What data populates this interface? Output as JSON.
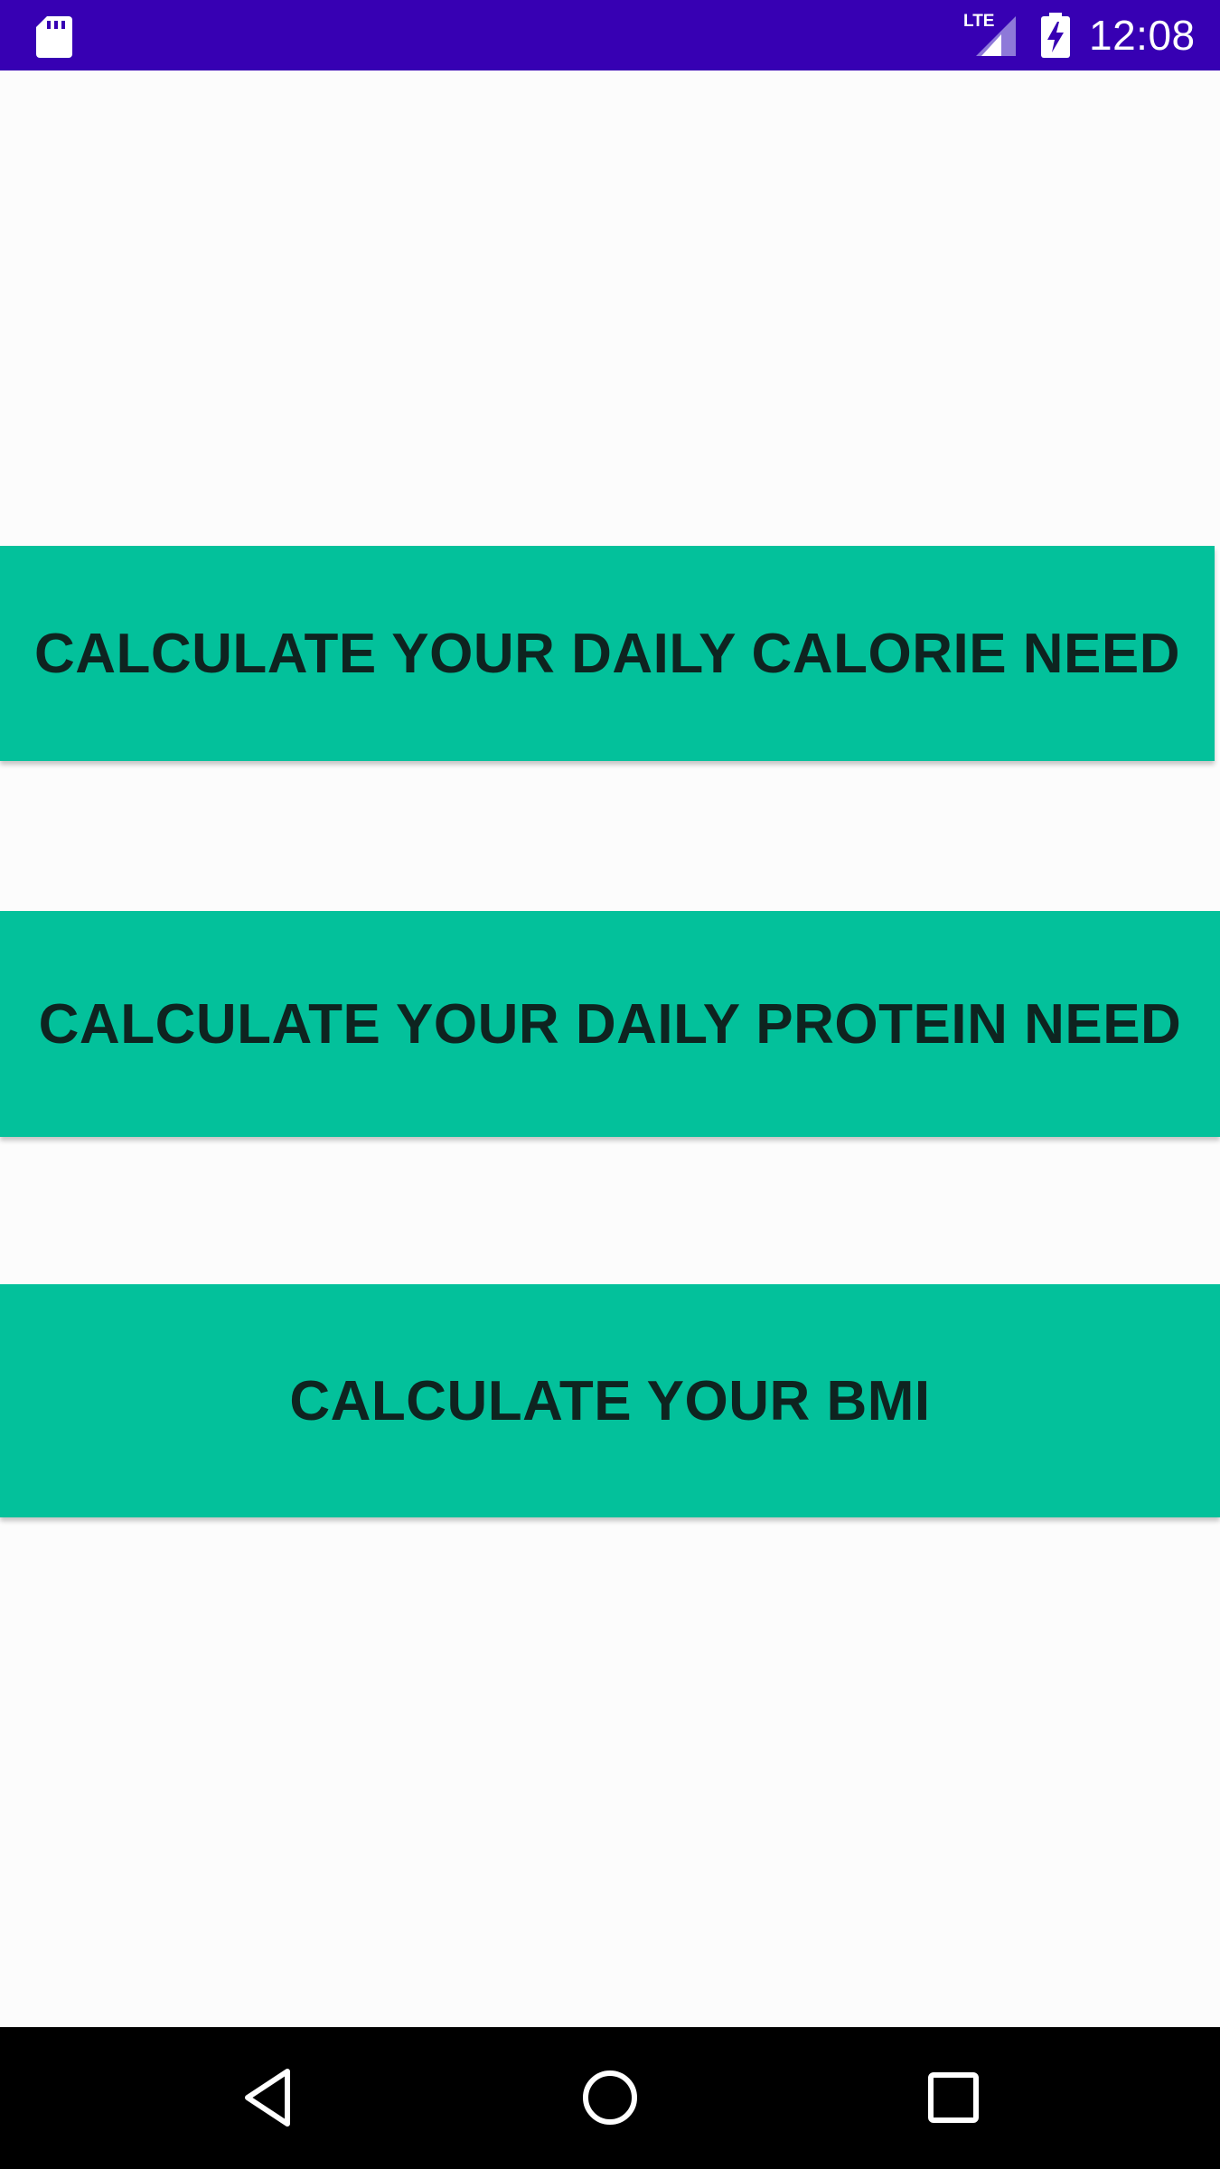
{
  "status_bar": {
    "time": "12:08",
    "network": "LTE",
    "icons": [
      "sd-card-icon",
      "lte-signal-icon",
      "battery-charging-icon"
    ],
    "background_color": "#3700b3"
  },
  "main": {
    "buttons": [
      {
        "label": "CALCULATE YOUR DAILY CALORIE NEED"
      },
      {
        "label": "CALCULATE YOUR DAILY PROTEIN NEED"
      },
      {
        "label": "CALCULATE YOUR BMI"
      }
    ],
    "button_color": "#03c19b"
  },
  "nav_bar": {
    "icons": [
      "back-icon",
      "home-icon",
      "recents-icon"
    ]
  }
}
